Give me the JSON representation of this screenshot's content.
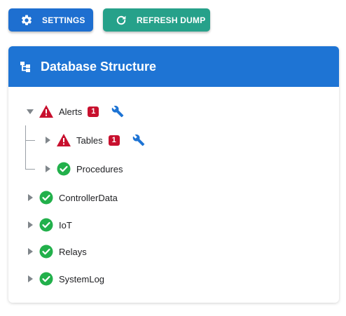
{
  "toolbar": {
    "settings_label": "SETTINGS",
    "refresh_label": "REFRESH DUMP"
  },
  "panel": {
    "title": "Database Structure"
  },
  "tree": {
    "alerts": {
      "label": "Alerts",
      "badge": "1",
      "status": "warning",
      "expanded": true
    },
    "tables": {
      "label": "Tables",
      "badge": "1",
      "status": "warning",
      "expanded": false
    },
    "procedures": {
      "label": "Procedures",
      "status": "ok",
      "expanded": false
    },
    "controllerdata": {
      "label": "ControllerData",
      "status": "ok",
      "expanded": false
    },
    "iot": {
      "label": "IoT",
      "status": "ok",
      "expanded": false
    },
    "relays": {
      "label": "Relays",
      "status": "ok",
      "expanded": false
    },
    "systemlog": {
      "label": "SystemLog",
      "status": "ok",
      "expanded": false
    }
  },
  "colors": {
    "primary": "#1e74d4",
    "accent": "#26a18a",
    "warning": "#c8102e",
    "ok": "#22b04b"
  },
  "icons": {
    "settings": "gear-icon",
    "refresh": "refresh-icon",
    "header": "tree-structure-icon",
    "warning": "warning-triangle-icon",
    "ok": "check-circle-icon",
    "tool": "wrench-icon"
  }
}
